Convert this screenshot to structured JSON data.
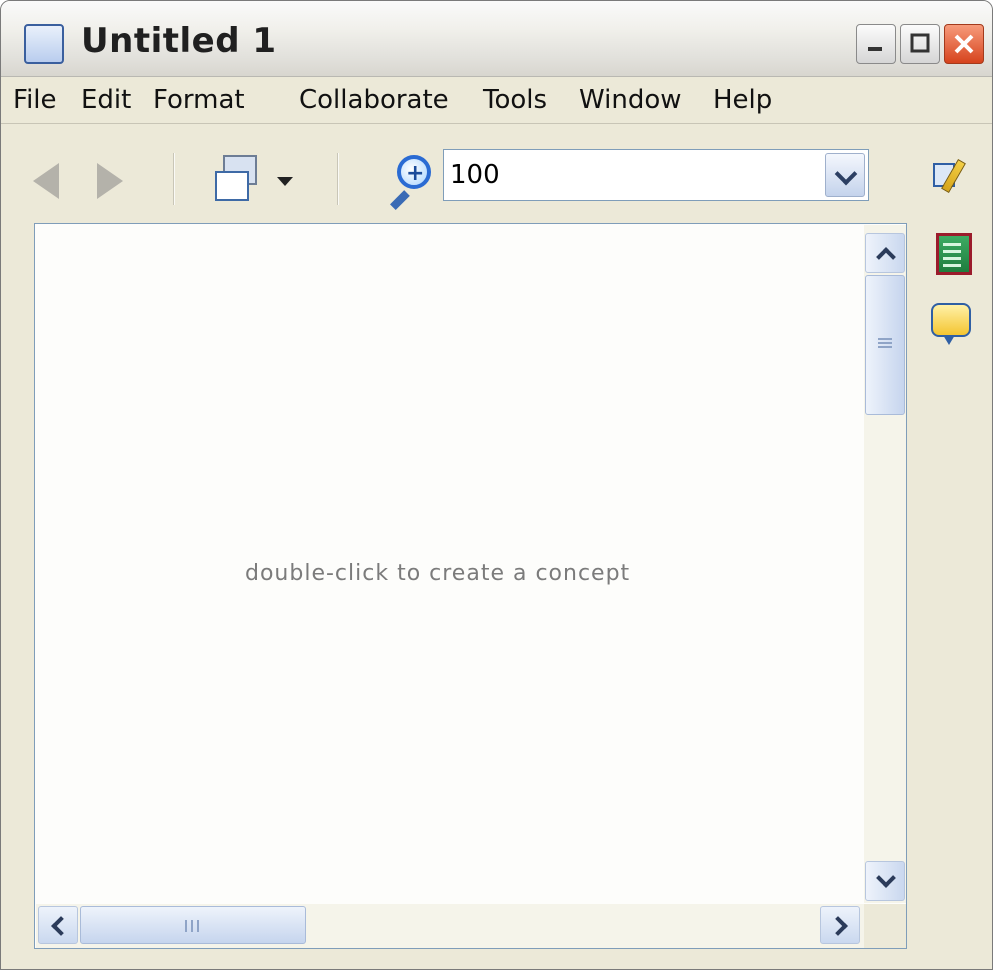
{
  "window": {
    "title": "Untitled 1",
    "icon": "concept-map-app-icon",
    "controls": [
      "minimize-icon",
      "maximize-icon",
      "close-icon"
    ]
  },
  "menu": {
    "items": [
      "File",
      "Edit",
      "Format",
      "Collaborate",
      "Tools",
      "Window",
      "Help"
    ]
  },
  "toolbar": {
    "back_icon": "back-arrow-icon",
    "forward_icon": "forward-arrow-icon",
    "view_icon": "view-mode-icon",
    "zoom_icon": "zoom-in-icon",
    "zoom_value": "100"
  },
  "side_panel": {
    "icons": [
      "edit-style-icon",
      "notes-icon",
      "collaborate-icon"
    ]
  },
  "canvas": {
    "hint": "double-click to create a concept"
  },
  "colors": {
    "chrome": "#ece9d8",
    "canvas_bg": "#fdfdfb",
    "hint_text": "#7b7b7b",
    "close_button": "#d6431d"
  }
}
